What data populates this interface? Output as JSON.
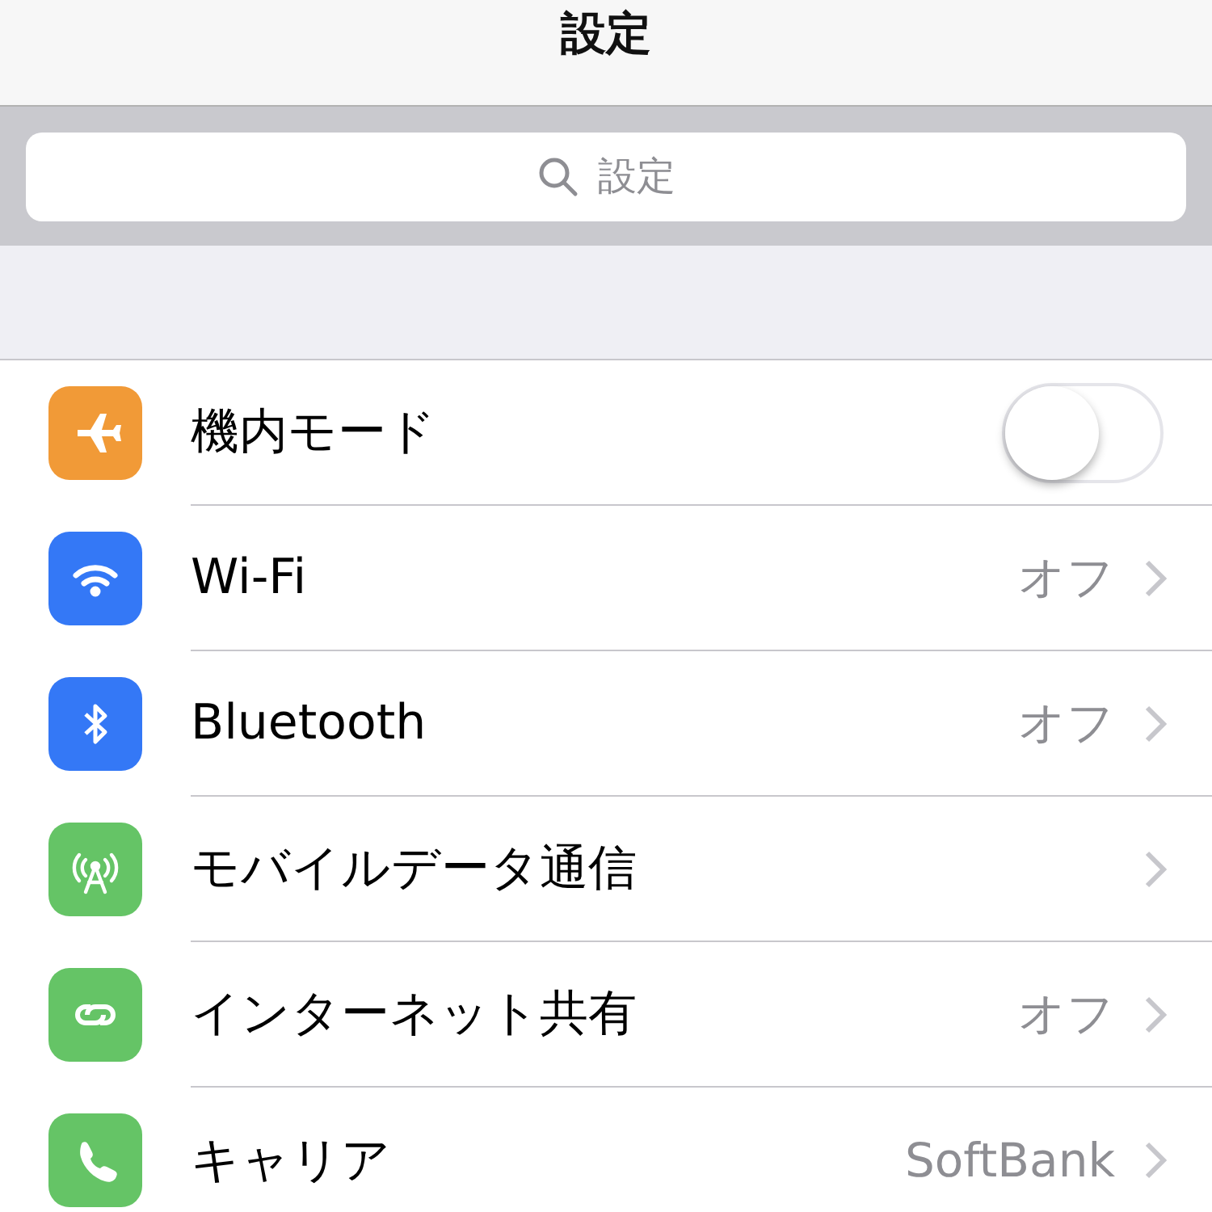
{
  "navigation_bar": {
    "title": "設定"
  },
  "search": {
    "placeholder": "設定"
  },
  "rows": [
    {
      "kind": "toggle",
      "label": "機内モード",
      "color": "#f19a37",
      "on": false
    },
    {
      "kind": "link",
      "label": "Wi-Fi",
      "color": "#3478f6",
      "value": "オフ"
    },
    {
      "kind": "link",
      "label": "Bluetooth",
      "color": "#3478f6",
      "value": "オフ"
    },
    {
      "kind": "link",
      "label": "モバイルデータ通信",
      "color": "#65c466"
    },
    {
      "kind": "link",
      "label": "インターネット共有",
      "color": "#65c466",
      "value": "オフ"
    },
    {
      "kind": "link",
      "label": "キャリア",
      "color": "#65c466",
      "value": "SoftBank"
    }
  ]
}
